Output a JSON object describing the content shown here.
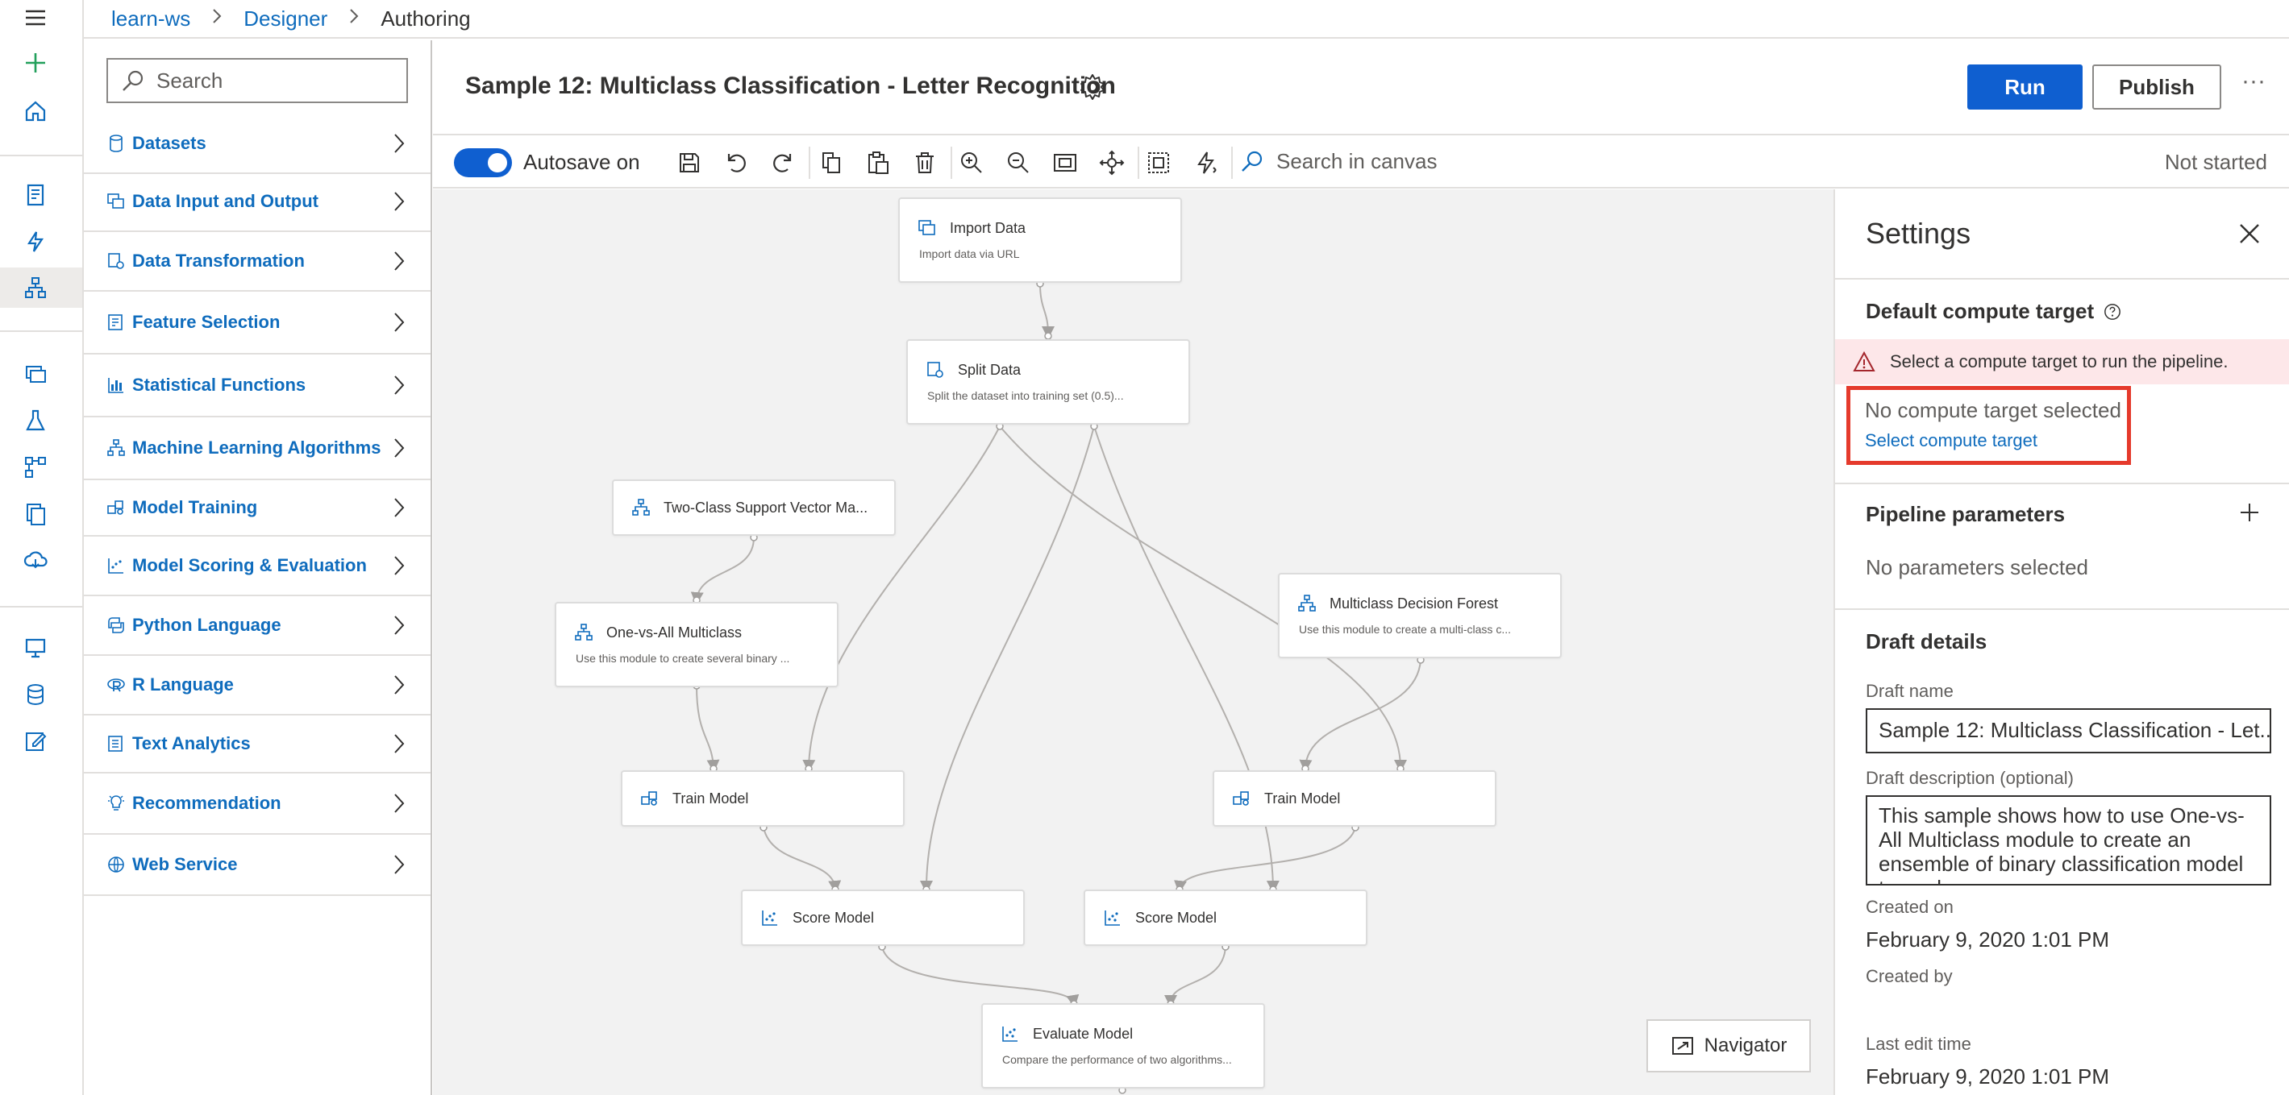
{
  "breadcrumb": {
    "workspace": "learn-ws",
    "section": "Designer",
    "page": "Authoring"
  },
  "palette": {
    "search_placeholder": "Search",
    "categories": [
      {
        "label": "Datasets",
        "icon": "datasets-icon"
      },
      {
        "label": "Data Input and Output",
        "icon": "data-input-output-icon"
      },
      {
        "label": "Data Transformation",
        "icon": "data-transformation-icon"
      },
      {
        "label": "Feature Selection",
        "icon": "feature-selection-icon"
      },
      {
        "label": "Statistical Functions",
        "icon": "statistical-functions-icon"
      },
      {
        "label": "Machine Learning Algorithms",
        "icon": "ml-algorithms-icon"
      },
      {
        "label": "Model Training",
        "icon": "model-training-icon"
      },
      {
        "label": "Model Scoring & Evaluation",
        "icon": "model-scoring-icon"
      },
      {
        "label": "Python Language",
        "icon": "python-icon"
      },
      {
        "label": "R Language",
        "icon": "r-language-icon"
      },
      {
        "label": "Text Analytics",
        "icon": "text-analytics-icon"
      },
      {
        "label": "Recommendation",
        "icon": "recommendation-icon"
      },
      {
        "label": "Web Service",
        "icon": "web-service-icon"
      }
    ]
  },
  "header": {
    "title": "Sample 12: Multiclass Classification - Letter Recognition",
    "run_label": "Run",
    "publish_label": "Publish",
    "more_label": "···"
  },
  "toolbar": {
    "autosave_label": "Autosave on",
    "autosave_on": true,
    "search_placeholder": "Search in canvas",
    "status": "Not started"
  },
  "canvas": {
    "nodes": [
      {
        "id": "import",
        "title": "Import Data",
        "subtitle": "Import data via URL"
      },
      {
        "id": "split",
        "title": "Split Data",
        "subtitle": "Split the dataset into training set (0.5)..."
      },
      {
        "id": "svm",
        "title": "Two-Class Support Vector Ma...",
        "subtitle": ""
      },
      {
        "id": "ova",
        "title": "One-vs-All Multiclass",
        "subtitle": "Use this module to create several binary ..."
      },
      {
        "id": "mdf",
        "title": "Multiclass Decision Forest",
        "subtitle": "Use this module to create a multi-class c..."
      },
      {
        "id": "train1",
        "title": "Train Model",
        "subtitle": ""
      },
      {
        "id": "train2",
        "title": "Train Model",
        "subtitle": ""
      },
      {
        "id": "score1",
        "title": "Score Model",
        "subtitle": ""
      },
      {
        "id": "score2",
        "title": "Score Model",
        "subtitle": ""
      },
      {
        "id": "eval",
        "title": "Evaluate Model",
        "subtitle": "Compare the performance of two algorithms..."
      }
    ],
    "navigator_label": "Navigator"
  },
  "settings": {
    "title": "Settings",
    "compute_title": "Default compute target",
    "error_message": "Select a compute target to run the pipeline.",
    "no_compute": "No compute target selected",
    "select_compute": "Select compute target",
    "params_title": "Pipeline parameters",
    "no_params": "No parameters selected",
    "draft_title": "Draft details",
    "draft_name_label": "Draft name",
    "draft_name_value": "Sample 12: Multiclass Classification - Let...",
    "draft_desc_label": "Draft description (optional)",
    "draft_desc_value": "This sample shows how to use One-vs-All Multiclass module to create an ensemble of binary classification model to analyze",
    "created_on_label": "Created on",
    "created_on_value": "February 9, 2020 1:01 PM",
    "created_by_label": "Created by",
    "last_edit_label": "Last edit time",
    "last_edit_value": "February 9, 2020 1:01 PM"
  },
  "colors": {
    "accent": "#0f5fd0",
    "link": "#0f6cbd",
    "error_bg": "#fde7e9",
    "highlight": "#e53a2c",
    "canvas_bg": "#f2f2f2"
  }
}
